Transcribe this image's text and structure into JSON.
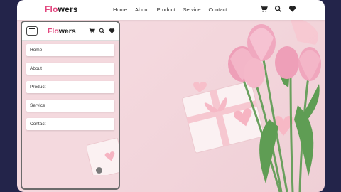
{
  "brand": {
    "first": "Flo",
    "second": "wers"
  },
  "nav": [
    "Home",
    "About",
    "Product",
    "Service",
    "Contact"
  ],
  "icons": [
    "cart-icon",
    "search-icon",
    "heart-icon"
  ],
  "mobile": {
    "brand": {
      "first": "Flo",
      "second": "wers"
    },
    "menu": [
      "Home",
      "About",
      "Product",
      "Service",
      "Contact"
    ]
  },
  "colors": {
    "accent": "#e2467e",
    "background": "#23244a",
    "page": "#f4d9de"
  }
}
